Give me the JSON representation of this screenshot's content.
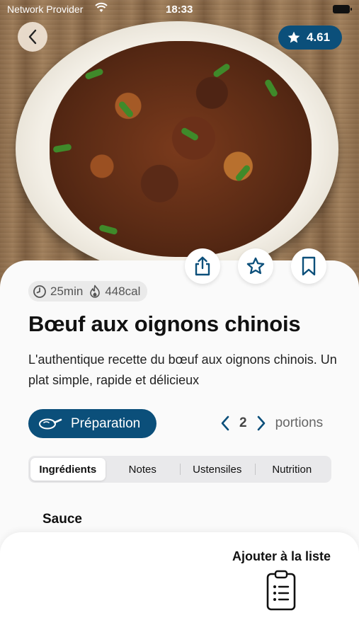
{
  "status_bar": {
    "provider": "Network Provider",
    "time": "18:33"
  },
  "hero": {
    "image_desc_icon": "recipe-photo",
    "back_icon": "chevron-left-icon",
    "rating": "4.61"
  },
  "actions": {
    "share_icon": "share-icon",
    "favorite_icon": "star-icon",
    "bookmark_icon": "bookmark-icon"
  },
  "meta": {
    "time": "25min",
    "calories": "448cal"
  },
  "recipe": {
    "title": "Bœuf aux oignons chinois",
    "description": "L'authentique recette du bœuf aux oignons chinois. Un plat simple, rapide et délicieux"
  },
  "preparation_button": "Préparation",
  "portions": {
    "count": "2",
    "label": "portions"
  },
  "tabs": [
    {
      "label": "Ingrédients",
      "active": true
    },
    {
      "label": "Notes",
      "active": false
    },
    {
      "label": "Ustensiles",
      "active": false
    },
    {
      "label": "Nutrition",
      "active": false
    }
  ],
  "section": {
    "title": "Sauce"
  },
  "bottom": {
    "add_to_list": "Ajouter à la liste"
  },
  "colors": {
    "accent": "#0b4f7a",
    "background": "#fafafa"
  }
}
